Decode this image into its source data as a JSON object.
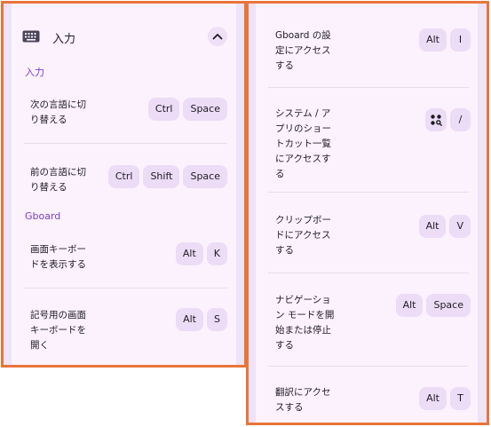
{
  "left": {
    "header": {
      "title": "入力",
      "icon": "keyboard-icon",
      "toggle_icon": "chevron-up-icon"
    },
    "sections": [
      {
        "label": "入力"
      },
      {
        "label": "Gboard"
      }
    ],
    "shortcuts": [
      {
        "desc": "次の言語に切\nり替える",
        "keys": [
          "Ctrl",
          "Space"
        ]
      },
      {
        "desc": "前の言語に切\nり替える",
        "keys": [
          "Ctrl",
          "Shift",
          "Space"
        ]
      },
      {
        "desc": "画面キーボー\nドを表示する",
        "keys": [
          "Alt",
          "K"
        ]
      },
      {
        "desc": "記号用の画面\nキーボードを\n開く",
        "keys": [
          "Alt",
          "S"
        ]
      }
    ]
  },
  "right": {
    "shortcuts": [
      {
        "desc": "Gboard の設\n定にアクセス\nする",
        "keys": [
          "Alt",
          "I"
        ]
      },
      {
        "desc": "システム / ア\nプリのショー\nトカット一覧\nにアクセスす\nる",
        "keys": [
          "launcher-search-icon",
          "/"
        ]
      },
      {
        "desc": "クリップボー\nドにアクセス\nする",
        "keys": [
          "Alt",
          "V"
        ]
      },
      {
        "desc": "ナビゲーショ\nン モードを開\n始または停止\nする",
        "keys": [
          "Alt",
          "Space"
        ]
      },
      {
        "desc": "翻訳にアクセ\nスする",
        "keys": [
          "Alt",
          "T"
        ]
      }
    ]
  }
}
